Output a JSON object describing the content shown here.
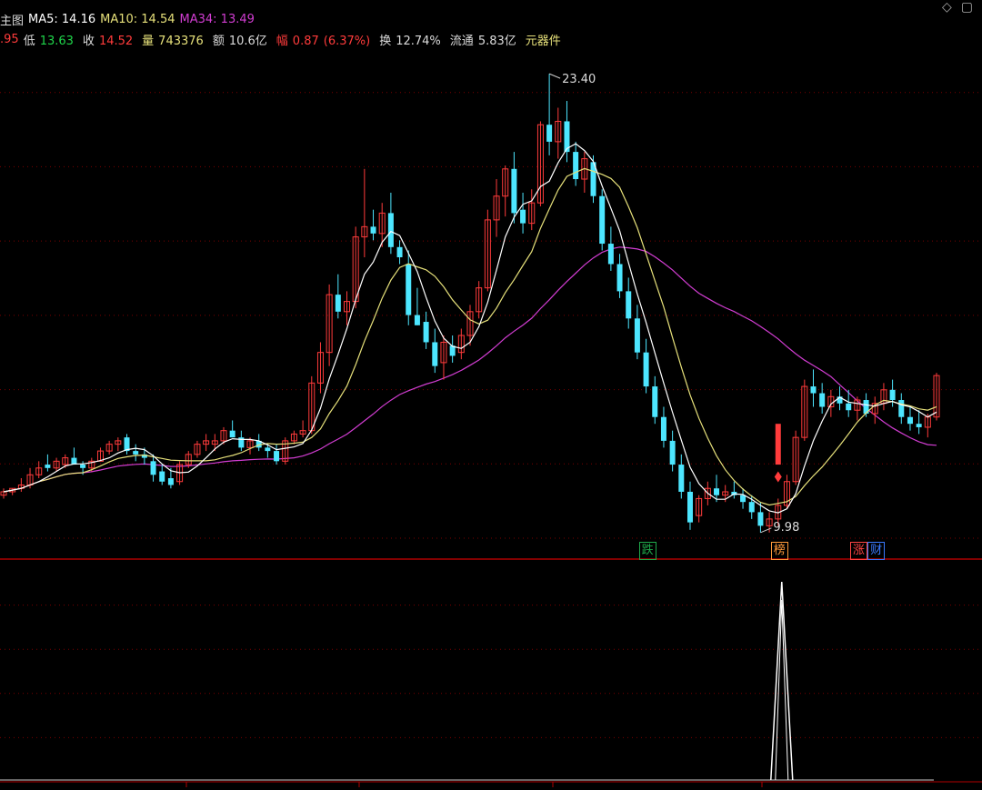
{
  "header": {
    "title": "主图",
    "open_partial": ".95",
    "low_label": "低",
    "low": "13.63",
    "close_label": "收",
    "close": "14.52",
    "volume_label": "量",
    "volume": "743376",
    "amount_label": "额",
    "amount": "10.6亿",
    "change_label": "幅",
    "change": "0.87",
    "change_pct": "(6.37%)",
    "turnover_label": "换",
    "turnover": "12.74%",
    "float_label": "流通",
    "float": "5.83亿",
    "sector": "元器件",
    "ma5": "MA5: 14.16",
    "ma10": "MA10: 14.54",
    "ma34": "MA34: 13.49"
  },
  "window_icons": [
    "diamond-icon",
    "close-icon"
  ],
  "colors": {
    "up": "#ff3b3b",
    "down": "#4de6ff",
    "ma5": "#ffffff",
    "ma10": "#e6e07a",
    "ma34": "#d23dd2",
    "grid": "#7a0000",
    "axis": "#b00000",
    "bg": "#000000"
  },
  "chart_data": {
    "type": "candlestick",
    "annotations": {
      "high": "23.40",
      "low": "9.98"
    },
    "markers": [
      {
        "text": "跌",
        "index": 73,
        "color": "#1fa84a"
      },
      {
        "text": "榜",
        "index": 88,
        "color": "#ff9a3a"
      },
      {
        "text": "涨",
        "index": 97,
        "color": "#ff4444"
      },
      {
        "text": "财",
        "index": 99,
        "color": "#3a7aff"
      }
    ],
    "ylim": [
      9.2,
      24.5
    ],
    "candles": [
      [
        11.0,
        11.2,
        10.9,
        11.1
      ],
      [
        11.1,
        11.2,
        11.0,
        11.2
      ],
      [
        11.2,
        11.5,
        11.1,
        11.3
      ],
      [
        11.3,
        11.8,
        11.2,
        11.6
      ],
      [
        11.6,
        12.0,
        11.5,
        11.8
      ],
      [
        11.9,
        12.2,
        11.7,
        11.8
      ],
      [
        11.8,
        12.1,
        11.7,
        12.0
      ],
      [
        11.9,
        12.2,
        11.8,
        12.1
      ],
      [
        12.1,
        12.4,
        11.9,
        11.9
      ],
      [
        11.9,
        12.0,
        11.6,
        11.8
      ],
      [
        11.8,
        12.1,
        11.7,
        12.0
      ],
      [
        12.0,
        12.4,
        12.0,
        12.3
      ],
      [
        12.3,
        12.6,
        12.2,
        12.5
      ],
      [
        12.5,
        12.7,
        12.3,
        12.6
      ],
      [
        12.7,
        12.8,
        12.2,
        12.3
      ],
      [
        12.3,
        12.5,
        12.0,
        12.2
      ],
      [
        12.2,
        12.4,
        11.9,
        12.1
      ],
      [
        12.0,
        12.2,
        11.4,
        11.6
      ],
      [
        11.7,
        11.9,
        11.3,
        11.4
      ],
      [
        11.5,
        11.8,
        11.2,
        11.3
      ],
      [
        11.4,
        12.0,
        11.3,
        11.9
      ],
      [
        11.9,
        12.3,
        11.8,
        12.2
      ],
      [
        12.2,
        12.6,
        12.1,
        12.5
      ],
      [
        12.5,
        12.8,
        12.3,
        12.6
      ],
      [
        12.5,
        12.8,
        12.3,
        12.6
      ],
      [
        12.6,
        13.0,
        12.5,
        12.9
      ],
      [
        12.9,
        13.2,
        12.7,
        12.7
      ],
      [
        12.7,
        12.9,
        12.3,
        12.4
      ],
      [
        12.4,
        12.7,
        12.2,
        12.6
      ],
      [
        12.6,
        12.8,
        12.3,
        12.4
      ],
      [
        12.4,
        12.5,
        12.1,
        12.3
      ],
      [
        12.3,
        12.5,
        11.9,
        12.0
      ],
      [
        12.0,
        12.7,
        11.9,
        12.6
      ],
      [
        12.6,
        12.9,
        12.5,
        12.8
      ],
      [
        12.8,
        13.2,
        12.7,
        12.9
      ],
      [
        12.9,
        14.5,
        12.8,
        14.3
      ],
      [
        14.3,
        15.5,
        14.0,
        15.2
      ],
      [
        15.2,
        17.2,
        14.8,
        16.9
      ],
      [
        16.9,
        17.5,
        16.2,
        16.4
      ],
      [
        16.4,
        17.0,
        16.0,
        16.7
      ],
      [
        16.7,
        18.9,
        16.5,
        18.6
      ],
      [
        18.6,
        20.6,
        18.0,
        18.9
      ],
      [
        18.9,
        19.4,
        18.5,
        18.7
      ],
      [
        18.7,
        19.6,
        18.3,
        19.3
      ],
      [
        19.3,
        19.9,
        18.1,
        18.3
      ],
      [
        18.3,
        18.5,
        17.8,
        18.0
      ],
      [
        17.8,
        18.2,
        16.0,
        16.3
      ],
      [
        16.3,
        17.1,
        16.0,
        16.0
      ],
      [
        16.1,
        16.4,
        15.3,
        15.5
      ],
      [
        15.5,
        15.9,
        14.6,
        14.8
      ],
      [
        14.9,
        15.7,
        14.4,
        15.5
      ],
      [
        15.4,
        15.7,
        14.9,
        15.1
      ],
      [
        15.2,
        15.9,
        15.0,
        15.7
      ],
      [
        15.7,
        16.6,
        15.4,
        16.4
      ],
      [
        16.4,
        17.3,
        16.2,
        17.1
      ],
      [
        17.1,
        19.4,
        17.0,
        19.1
      ],
      [
        19.1,
        20.3,
        18.6,
        19.8
      ],
      [
        19.8,
        20.7,
        19.2,
        20.6
      ],
      [
        20.6,
        21.1,
        19.0,
        19.3
      ],
      [
        19.4,
        19.9,
        18.7,
        19.0
      ],
      [
        19.0,
        20.0,
        18.8,
        19.6
      ],
      [
        19.6,
        22.0,
        19.5,
        21.9
      ],
      [
        21.9,
        23.4,
        21.0,
        21.4
      ],
      [
        21.4,
        22.4,
        20.9,
        22.0
      ],
      [
        22.0,
        22.6,
        20.8,
        21.1
      ],
      [
        21.1,
        21.4,
        20.1,
        20.3
      ],
      [
        20.3,
        21.1,
        19.9,
        20.9
      ],
      [
        20.8,
        21.0,
        19.6,
        19.8
      ],
      [
        19.8,
        20.0,
        18.2,
        18.4
      ],
      [
        18.4,
        18.9,
        17.6,
        17.8
      ],
      [
        17.8,
        18.1,
        16.8,
        17.0
      ],
      [
        17.0,
        17.4,
        15.9,
        16.2
      ],
      [
        16.2,
        16.6,
        15.0,
        15.2
      ],
      [
        15.2,
        15.6,
        14.0,
        14.2
      ],
      [
        14.2,
        14.5,
        13.1,
        13.3
      ],
      [
        13.3,
        13.6,
        12.4,
        12.6
      ],
      [
        12.6,
        12.9,
        11.7,
        11.9
      ],
      [
        11.9,
        12.2,
        10.9,
        11.1
      ],
      [
        11.1,
        11.4,
        9.98,
        10.2
      ],
      [
        10.4,
        11.0,
        10.2,
        10.9
      ],
      [
        10.9,
        11.4,
        10.7,
        11.2
      ],
      [
        11.2,
        11.6,
        10.8,
        11.0
      ],
      [
        11.0,
        11.3,
        10.8,
        11.1
      ],
      [
        11.1,
        11.4,
        10.9,
        11.0
      ],
      [
        11.0,
        11.2,
        10.6,
        10.8
      ],
      [
        10.8,
        11.0,
        10.3,
        10.5
      ],
      [
        10.5,
        10.8,
        9.9,
        10.1
      ],
      [
        10.1,
        10.5,
        9.9,
        10.3
      ],
      [
        10.3,
        10.9,
        10.1,
        10.7
      ],
      [
        10.7,
        11.6,
        10.6,
        11.4
      ],
      [
        11.4,
        12.9,
        11.3,
        12.7
      ],
      [
        12.7,
        14.4,
        12.6,
        14.2
      ],
      [
        14.2,
        14.7,
        13.6,
        14.0
      ],
      [
        14.0,
        14.3,
        13.4,
        13.6
      ],
      [
        13.6,
        14.1,
        13.3,
        13.9
      ],
      [
        13.9,
        14.2,
        13.5,
        13.7
      ],
      [
        13.7,
        14.1,
        13.3,
        13.5
      ],
      [
        13.5,
        13.9,
        13.2,
        13.8
      ],
      [
        13.8,
        14.0,
        13.3,
        13.4
      ],
      [
        13.4,
        13.9,
        13.1,
        13.7
      ],
      [
        13.7,
        14.3,
        13.5,
        14.1
      ],
      [
        14.1,
        14.4,
        13.6,
        13.8
      ],
      [
        13.8,
        14.0,
        13.1,
        13.3
      ],
      [
        13.3,
        13.6,
        12.9,
        13.1
      ],
      [
        13.1,
        13.5,
        12.8,
        13.0
      ],
      [
        13.0,
        13.4,
        12.7,
        13.3
      ],
      [
        13.3,
        14.6,
        13.2,
        14.52
      ]
    ],
    "indicator": {
      "spike_index": 88
    }
  }
}
